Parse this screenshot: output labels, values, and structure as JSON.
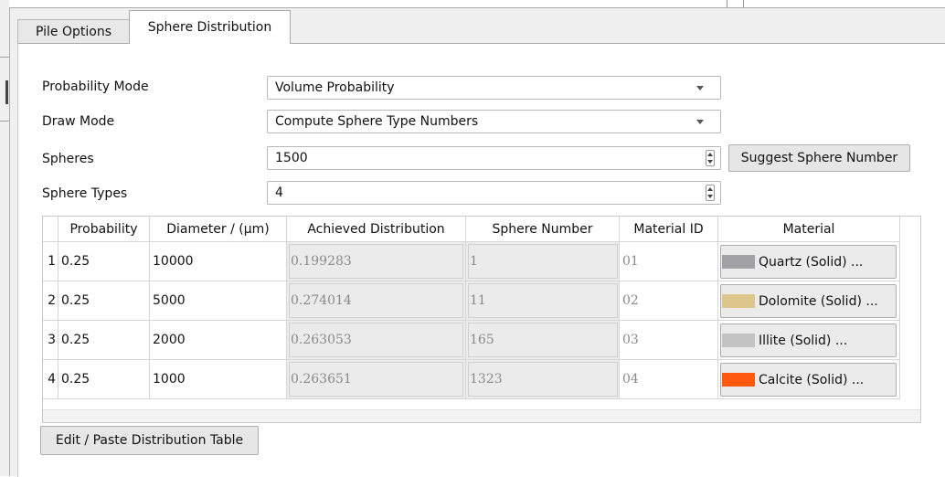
{
  "tabs": [
    {
      "label": "Pile Options"
    },
    {
      "label": "Sphere Distribution"
    }
  ],
  "form": {
    "probability_mode_label": "Probability Mode",
    "probability_mode_value": "Volume Probability",
    "draw_mode_label": "Draw Mode",
    "draw_mode_value": "Compute Sphere Type Numbers",
    "spheres_label": "Spheres",
    "spheres_value": "1500",
    "suggest_button": "Suggest Sphere Number",
    "sphere_types_label": "Sphere Types",
    "sphere_types_value": "4"
  },
  "table": {
    "headers": [
      "Probability",
      "Diameter / (µm)",
      "Achieved Distribution",
      "Sphere Number",
      "Material ID",
      "Material"
    ],
    "rows": [
      {
        "index": "1",
        "probability": "0.25",
        "diameter": "10000",
        "achieved": "0.199283",
        "sphere_number": "1",
        "material_id": "01",
        "material": "Quartz (Solid) ...",
        "color": "#a1a1a6"
      },
      {
        "index": "2",
        "probability": "0.25",
        "diameter": "5000",
        "achieved": "0.274014",
        "sphere_number": "11",
        "material_id": "02",
        "material": "Dolomite (Solid) ...",
        "color": "#dcc68c"
      },
      {
        "index": "3",
        "probability": "0.25",
        "diameter": "2000",
        "achieved": "0.263053",
        "sphere_number": "165",
        "material_id": "03",
        "material": "Illite (Solid) ...",
        "color": "#c3c3c3"
      },
      {
        "index": "4",
        "probability": "0.25",
        "diameter": "1000",
        "achieved": "0.263651",
        "sphere_number": "1323",
        "material_id": "04",
        "material": "Calcite (Solid) ...",
        "color": "#ff5a0f"
      }
    ]
  },
  "edit_button": "Edit / Paste Distribution Table"
}
